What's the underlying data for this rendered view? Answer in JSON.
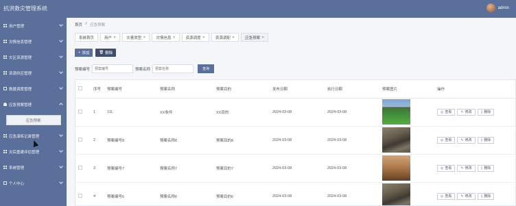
{
  "app": {
    "title": "抗洪救灾管理系统"
  },
  "user": {
    "name": "admin"
  },
  "sidebar": {
    "items": [
      {
        "label": "用户管理",
        "icon": "grid-icon"
      },
      {
        "label": "灾情信息管理",
        "icon": "grid-icon"
      },
      {
        "label": "灾区资源管理",
        "icon": "grid-icon"
      },
      {
        "label": "资源供应管理",
        "icon": "grid-icon"
      },
      {
        "label": "救援调度管理",
        "icon": "doc-icon"
      },
      {
        "label": "应急预案管理",
        "icon": "person-icon"
      },
      {
        "label": "应急演练记录管理",
        "icon": "grid-icon"
      },
      {
        "label": "灾后重建评估管理",
        "icon": "grid-icon"
      },
      {
        "label": "系统管理",
        "icon": "grid-icon"
      },
      {
        "label": "个人中心",
        "icon": "doc-icon"
      }
    ],
    "submenu_label": "应急预案"
  },
  "breadcrumb": {
    "home": "首页",
    "sep": "//",
    "current": "应急预案"
  },
  "tabs": [
    {
      "label": "系统首页",
      "closable": false
    },
    {
      "label": "用户",
      "closable": true
    },
    {
      "label": "灾害类型",
      "closable": true
    },
    {
      "label": "灾情信息",
      "closable": true
    },
    {
      "label": "资源调度",
      "closable": true
    },
    {
      "label": "资源调配",
      "closable": true
    },
    {
      "label": "应急预案",
      "closable": true
    }
  ],
  "toolbar": {
    "add_label": "添加",
    "delete_label": "删除"
  },
  "search": {
    "field1_label": "预案编号",
    "field1_placeholder": "预案编号",
    "field2_label": "预案名称",
    "field2_placeholder": "预案名称",
    "query_label": "查询"
  },
  "table": {
    "headers": [
      "",
      "序号",
      "预案编号",
      "预案名称",
      "预案目的",
      "发布日期",
      "执行日期",
      "预案图片",
      "操作"
    ],
    "rows": [
      {
        "index": "1",
        "code": "111",
        "name": "XX条件",
        "purpose": "XX目的",
        "publish_date": "2024-03-08",
        "exec_date": "2024-03-08",
        "image": "field"
      },
      {
        "index": "2",
        "code": "预案编号8",
        "name": "预案名称8",
        "purpose": "预案目的8",
        "publish_date": "2024-03-08",
        "exec_date": "2024-03-08",
        "image": "flood"
      },
      {
        "index": "3",
        "code": "预案编号7",
        "name": "预案名称7",
        "purpose": "预案目的7",
        "publish_date": "2024-03-08",
        "exec_date": "2024-03-08",
        "image": "dust"
      },
      {
        "index": "4",
        "code": "预案编号6",
        "name": "预案名称6",
        "purpose": "预案目的6",
        "publish_date": "2024-03-08",
        "exec_date": "2024-03-08",
        "image": "flood"
      }
    ],
    "row_actions": {
      "view": "查看",
      "edit": "修改",
      "delete": "删除"
    }
  },
  "colors": {
    "primary": "#5a6f9a",
    "dark": "#3d4d6b"
  }
}
